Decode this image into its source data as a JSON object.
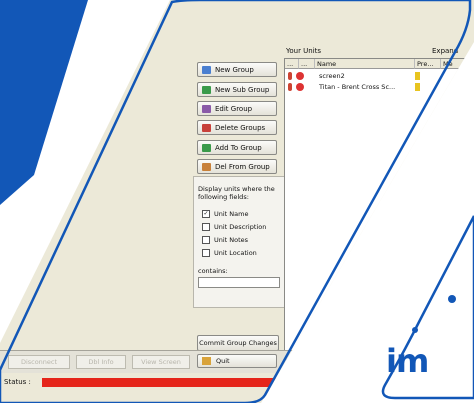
{
  "colors": {
    "brand_blue": "#1257b7",
    "status_red": "#e5251a",
    "window_bg": "#ece9d8"
  },
  "header": {
    "your_units": "Your Units",
    "expand": "Expand"
  },
  "group_buttons": [
    {
      "label": "New Group",
      "icon": "new-group-icon",
      "color": "#4a7fd0"
    },
    {
      "label": "New Sub Group",
      "icon": "new-subgroup-icon",
      "color": "#3a9a4a"
    },
    {
      "label": "Edit Group",
      "icon": "edit-group-icon",
      "color": "#8a5aa8"
    },
    {
      "label": "Delete Groups",
      "icon": "delete-groups-icon",
      "color": "#c8413a"
    },
    {
      "label": "Add To Group",
      "icon": "add-to-group-icon",
      "color": "#3a9a4a"
    },
    {
      "label": "Del From Group",
      "icon": "del-from-group-icon",
      "color": "#c8813a"
    }
  ],
  "filter": {
    "title": "Display units where the following fields:",
    "options": [
      {
        "label": "Unit Name",
        "checked": true
      },
      {
        "label": "Unit Description",
        "checked": false
      },
      {
        "label": "Unit Notes",
        "checked": false
      },
      {
        "label": "Unit Location",
        "checked": false
      }
    ],
    "contains_label": "contains:",
    "contains_value": ""
  },
  "grid": {
    "columns": [
      "...",
      "...",
      "Name",
      "Pre...",
      "Me"
    ],
    "rows": [
      {
        "name": "screen2"
      },
      {
        "name": "Titan - Brent Cross Sc..."
      }
    ]
  },
  "commit_label": "Commit Group Changes",
  "quit_label": "Quit",
  "bottom_buttons": [
    "Disconnect",
    "Dbl Info",
    "View Screen"
  ],
  "status": {
    "label": "Status :",
    "progress_fraction": 1.0
  },
  "logo": {
    "text": "im"
  }
}
